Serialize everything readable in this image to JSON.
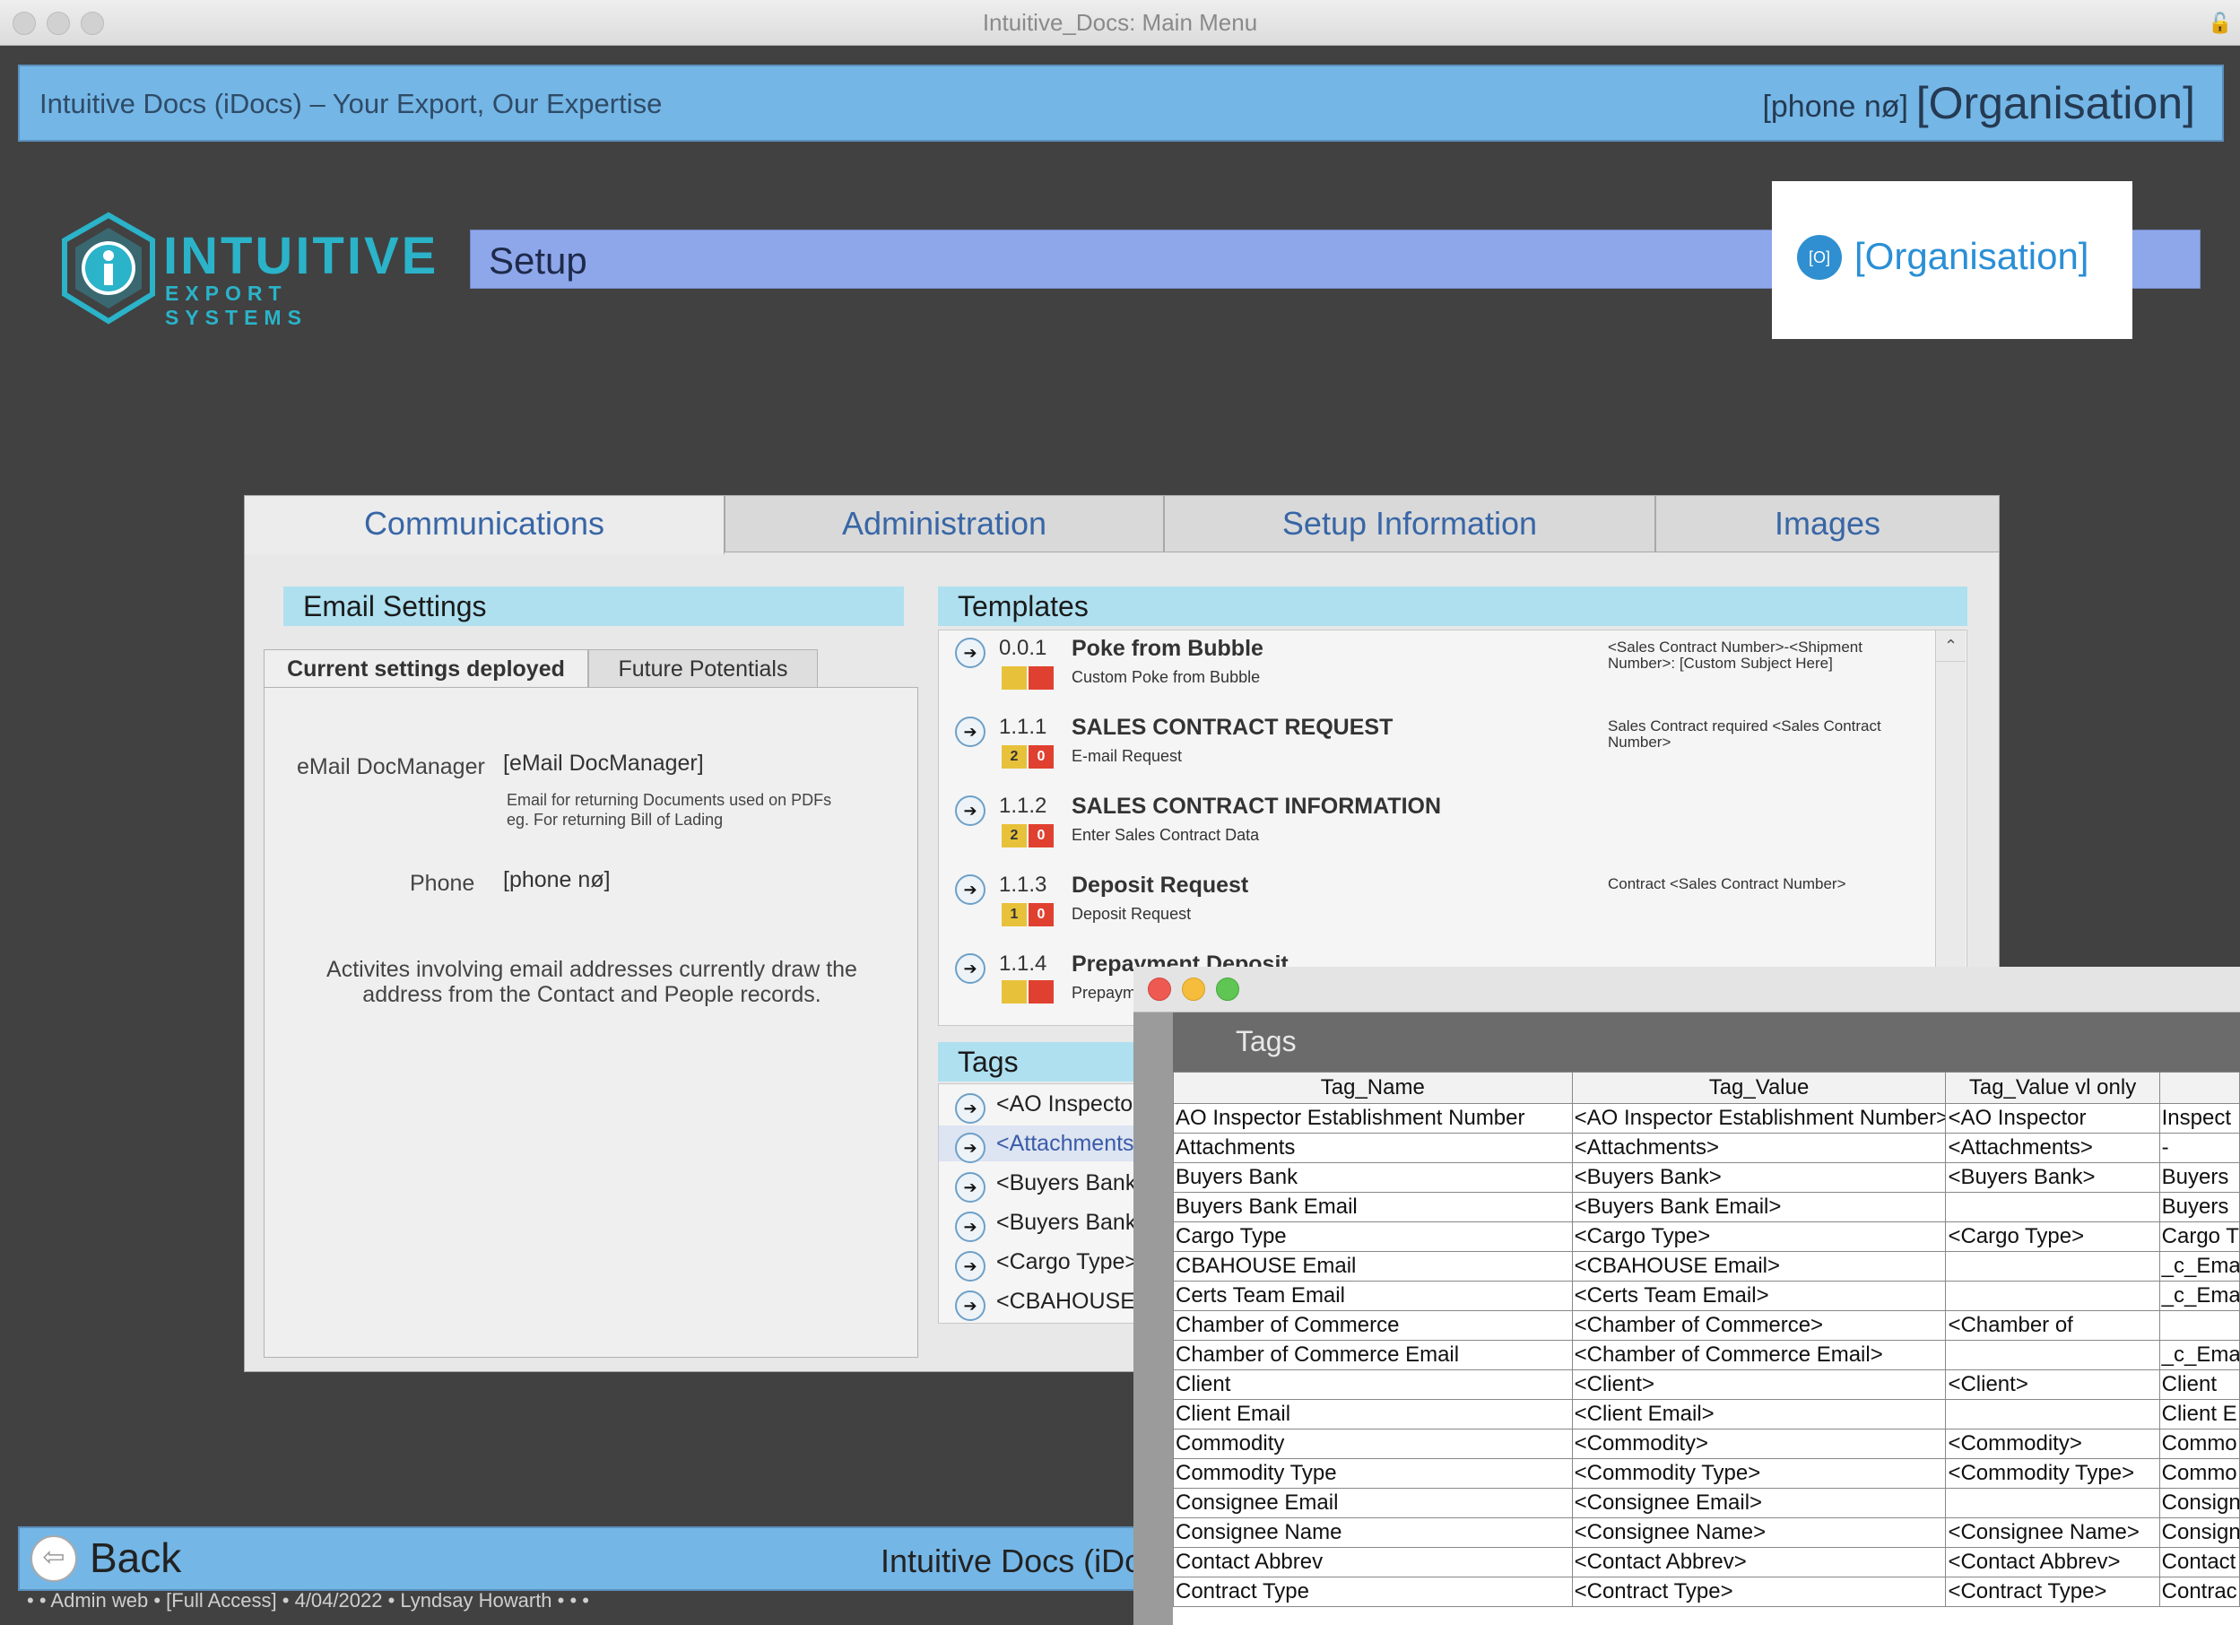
{
  "window": {
    "title": "Intuitive_Docs: Main Menu"
  },
  "header": {
    "tagline": "Intuitive Docs (iDocs) – Your Export, Our Expertise",
    "phone": "[phone nø]",
    "organisation": "[Organisation]"
  },
  "logo": {
    "word": "INTUITIVE",
    "sub": "EXPORT SYSTEMS"
  },
  "setup": {
    "title": "Setup",
    "org_card": "[Organisation]",
    "org_mark": "[O]"
  },
  "tabs": [
    "Communications",
    "Administration",
    "Setup Information",
    "Images"
  ],
  "email_settings": {
    "title": "Email Settings",
    "subtabs": [
      "Current settings deployed",
      "Future Potentials"
    ],
    "docmanager_label": "eMail DocManager",
    "docmanager_value": "[eMail DocManager]",
    "docmanager_note1": "Email for returning Documents used on PDFs",
    "docmanager_note2": "eg. For returning Bill of Lading",
    "phone_label": "Phone",
    "phone_value": "[phone nø]",
    "note_line1": "Activites involving email addresses currently draw the",
    "note_line2": "address from the Contact and People records."
  },
  "templates": {
    "title": "Templates",
    "items": [
      {
        "num": "0.0.1",
        "name": "Poke from Bubble",
        "desc": "Custom Poke from Bubble",
        "subject": "<Sales Contract Number>-<Shipment Number>: [Custom Subject Here]",
        "b1": "",
        "b2": ""
      },
      {
        "num": "1.1.1",
        "name": "SALES CONTRACT REQUEST",
        "desc": "E-mail Request",
        "subject": "Sales Contract required <Sales Contract Number>",
        "b1": "2",
        "b2": "0"
      },
      {
        "num": "1.1.2",
        "name": "SALES CONTRACT INFORMATION",
        "desc": "Enter Sales Contract Data",
        "subject": "",
        "b1": "2",
        "b2": "0"
      },
      {
        "num": "1.1.3",
        "name": "Deposit Request",
        "desc": "Deposit Request",
        "subject": "Contract <Sales Contract Number>",
        "b1": "1",
        "b2": "0"
      },
      {
        "num": "1.1.4",
        "name": "Prepayment Deposit",
        "desc": "Prepaym",
        "subject": "",
        "b1": "",
        "b2": ""
      }
    ]
  },
  "tags_panel": {
    "title": "Tags",
    "items": [
      "<AO Inspector",
      "<Attachments>",
      "<Buyers Bank>",
      "<Buyers Bank",
      "<Cargo Type>",
      "<CBAHOUSE"
    ]
  },
  "bottom": {
    "back": "Back",
    "name": "Intuitive Docs (iDocs",
    "status": "• • Admin web • [Full Access] • 4/04/2022 • Lyndsay Howarth • • •"
  },
  "tags_window": {
    "title": "Tags",
    "columns": [
      "Tag_Name",
      "Tag_Value",
      "Tag_Value vl only",
      ""
    ],
    "rows": [
      [
        "AO Inspector Establishment Number",
        "<AO Inspector Establishment Number>",
        "<AO Inspector",
        "Inspect"
      ],
      [
        "Attachments",
        "<Attachments>",
        "<Attachments>",
        "-"
      ],
      [
        "Buyers Bank",
        "<Buyers Bank>",
        "<Buyers Bank>",
        "Buyers"
      ],
      [
        "Buyers Bank Email",
        "<Buyers Bank Email>",
        "",
        "Buyers"
      ],
      [
        "Cargo Type",
        "<Cargo Type>",
        "<Cargo Type>",
        "Cargo T"
      ],
      [
        "CBAHOUSE Email",
        "<CBAHOUSE Email>",
        "",
        "_c_Ema"
      ],
      [
        "Certs Team Email",
        "<Certs Team Email>",
        "",
        "_c_Ema"
      ],
      [
        "Chamber of Commerce",
        "<Chamber of Commerce>",
        "<Chamber of",
        ""
      ],
      [
        "Chamber of Commerce Email",
        "<Chamber of Commerce Email>",
        "",
        "_c_Ema"
      ],
      [
        "Client",
        "<Client>",
        "<Client>",
        "Client"
      ],
      [
        "Client Email",
        "<Client Email>",
        "",
        "Client E"
      ],
      [
        "Commodity",
        "<Commodity>",
        "<Commodity>",
        "Commo"
      ],
      [
        "Commodity Type",
        "<Commodity Type>",
        "<Commodity Type>",
        "Commo"
      ],
      [
        "Consignee Email",
        "<Consignee Email>",
        "",
        "Consign"
      ],
      [
        "Consignee Name",
        "<Consignee Name>",
        "<Consignee Name>",
        "Consign"
      ],
      [
        "Contact Abbrev",
        "<Contact Abbrev>",
        "<Contact Abbrev>",
        "Contact"
      ],
      [
        "Contract Type",
        "<Contract Type>",
        "<Contract Type>",
        "Contrac"
      ]
    ]
  }
}
